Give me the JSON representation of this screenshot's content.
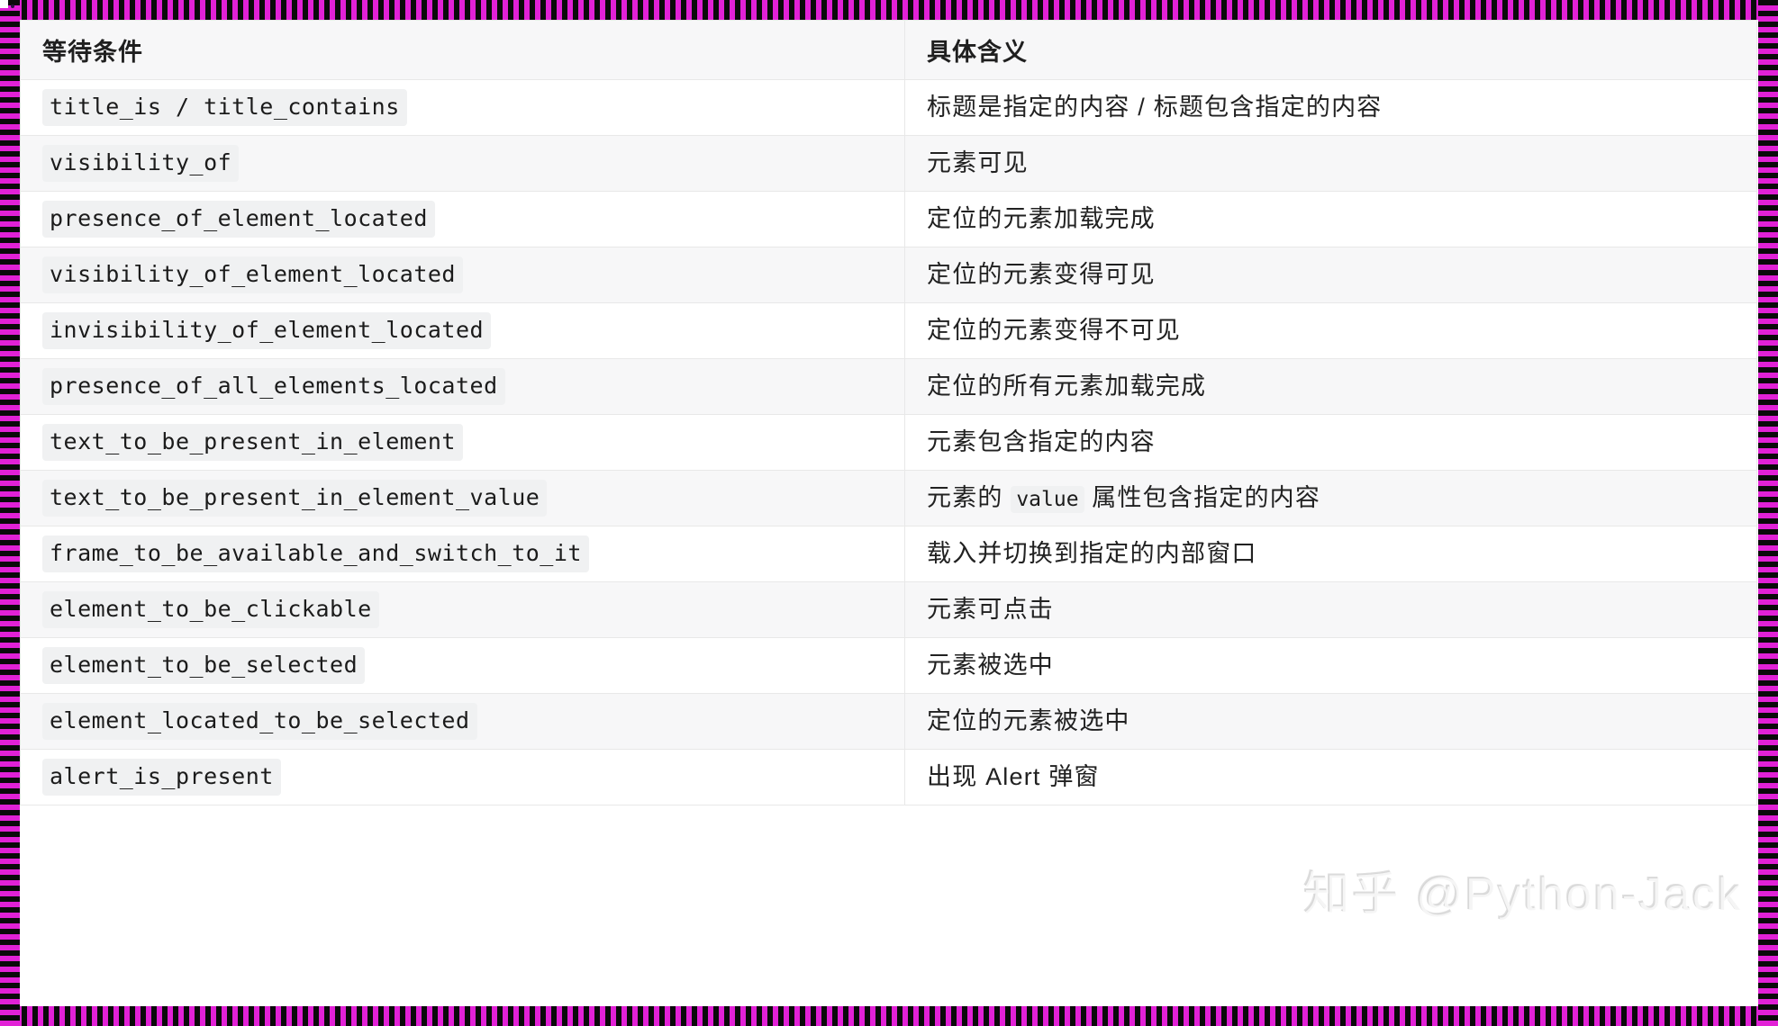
{
  "table": {
    "headers": [
      "等待条件",
      "具体含义"
    ],
    "rows": [
      {
        "condition": "title_is / title_contains",
        "meaning_pre": "标题是指定的内容 / 标题包含指定的内容",
        "meaning_code": "",
        "meaning_post": ""
      },
      {
        "condition": "visibility_of",
        "meaning_pre": "元素可见",
        "meaning_code": "",
        "meaning_post": ""
      },
      {
        "condition": "presence_of_element_located",
        "meaning_pre": "定位的元素加载完成",
        "meaning_code": "",
        "meaning_post": ""
      },
      {
        "condition": "visibility_of_element_located",
        "meaning_pre": "定位的元素变得可见",
        "meaning_code": "",
        "meaning_post": ""
      },
      {
        "condition": "invisibility_of_element_located",
        "meaning_pre": "定位的元素变得不可见",
        "meaning_code": "",
        "meaning_post": ""
      },
      {
        "condition": "presence_of_all_elements_located",
        "meaning_pre": "定位的所有元素加载完成",
        "meaning_code": "",
        "meaning_post": ""
      },
      {
        "condition": "text_to_be_present_in_element",
        "meaning_pre": "元素包含指定的内容",
        "meaning_code": "",
        "meaning_post": ""
      },
      {
        "condition": "text_to_be_present_in_element_value",
        "meaning_pre": "元素的 ",
        "meaning_code": "value",
        "meaning_post": " 属性包含指定的内容"
      },
      {
        "condition": "frame_to_be_available_and_switch_to_it",
        "meaning_pre": "载入并切换到指定的内部窗口",
        "meaning_code": "",
        "meaning_post": ""
      },
      {
        "condition": "element_to_be_clickable",
        "meaning_pre": "元素可点击",
        "meaning_code": "",
        "meaning_post": ""
      },
      {
        "condition": "element_to_be_selected",
        "meaning_pre": "元素被选中",
        "meaning_code": "",
        "meaning_post": ""
      },
      {
        "condition": "element_located_to_be_selected",
        "meaning_pre": "定位的元素被选中",
        "meaning_code": "",
        "meaning_post": ""
      },
      {
        "condition": "alert_is_present",
        "meaning_pre": "出现 Alert 弹窗",
        "meaning_code": "",
        "meaning_post": ""
      }
    ]
  },
  "watermark": {
    "text": "知乎 @Python-Jack"
  },
  "colors": {
    "frame_magenta": "#e121d6",
    "frame_black": "#0a0a0a",
    "row_alt_bg": "#f7f7f8",
    "row_bg": "#ffffff",
    "border": "#e8e8e8",
    "code_bg": "#f0f1f2",
    "text": "#212121"
  }
}
